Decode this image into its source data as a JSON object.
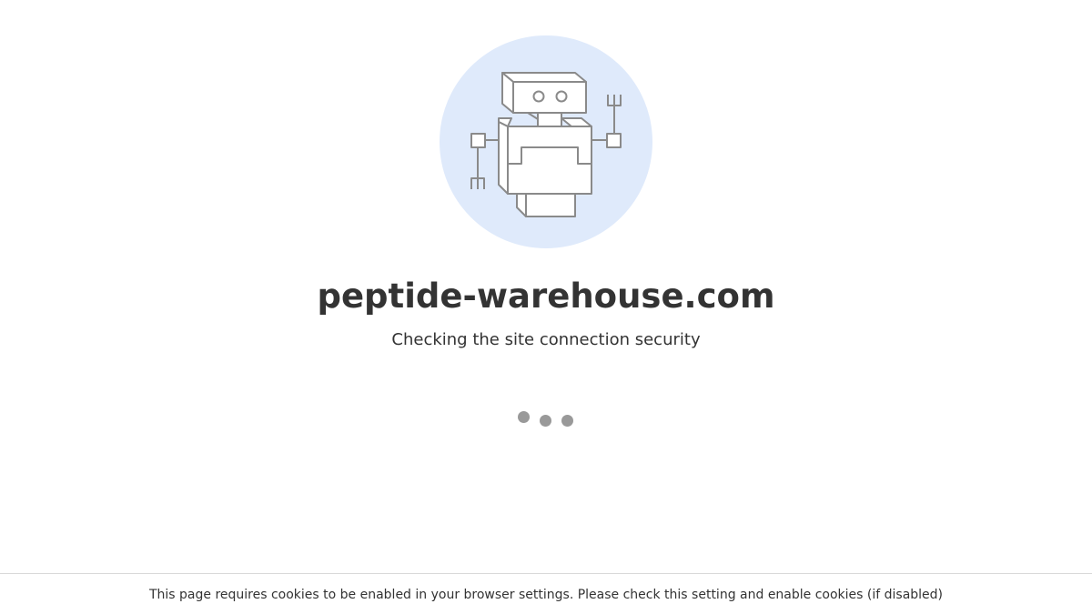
{
  "page": {
    "site_title": "peptide-warehouse.com",
    "status_text": "Checking the site connection security",
    "loader": {
      "dot_count": 3
    }
  },
  "footer": {
    "cookie_notice": "This page requires cookies to be enabled in your browser settings. Please check this setting and enable cookies (if disabled)"
  },
  "illustration": {
    "icon": "robot-icon",
    "circle_color": "#dfeafb",
    "stroke_color": "#8a8a8a"
  }
}
